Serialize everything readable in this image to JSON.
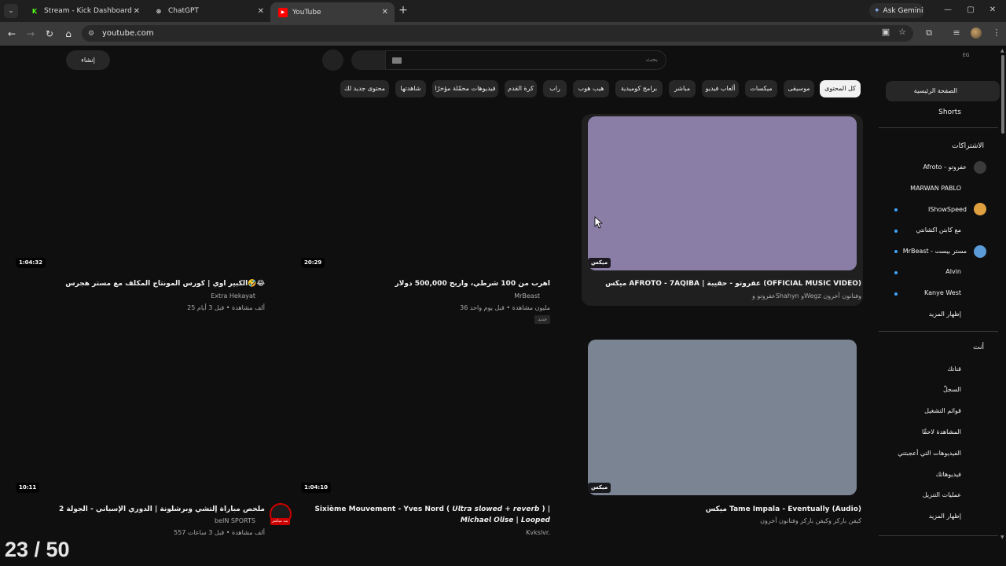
{
  "browser": {
    "tabs": [
      {
        "title": "Stream - Kick Dashboard",
        "favicon": "kick-icon",
        "color": "#53fc18"
      },
      {
        "title": "ChatGPT",
        "favicon": "chatgpt-icon",
        "color": "#e0e0e0"
      },
      {
        "title": "YouTube",
        "favicon": "youtube-icon",
        "color": "#ff0000",
        "active": true
      }
    ],
    "gemini_label": "Ask Gemini",
    "url": "youtube.com"
  },
  "header": {
    "create_label": "إنشاء",
    "search_placeholder": "بحث",
    "region": "EG"
  },
  "chips": [
    {
      "label": "كل المحتوى",
      "active": true
    },
    {
      "label": "موسيقى"
    },
    {
      "label": "ميكسات"
    },
    {
      "label": "ألعاب فيديو"
    },
    {
      "label": "مباشر"
    },
    {
      "label": "برامج كوميدية"
    },
    {
      "label": "هيب هوب"
    },
    {
      "label": "راب"
    },
    {
      "label": "كرة القدم"
    },
    {
      "label": "فيديوهات محمّلة مؤخرًا"
    },
    {
      "label": "شاهدتها"
    },
    {
      "label": "محتوى جديد لك"
    }
  ],
  "sidebar": {
    "home": "الصفحة الرئيسية",
    "shorts": "Shorts",
    "subs_heading": "الاشتراكات",
    "subscriptions": [
      {
        "name": "Afroto - عفروتو",
        "new": false
      },
      {
        "name": "MARWAN PABLO",
        "new": false
      },
      {
        "name": "IShowSpeed",
        "new": true
      },
      {
        "name": "مع كابتن اكشانتي",
        "new": true
      },
      {
        "name": "MrBeast - مستر بيست",
        "new": true
      },
      {
        "name": "Alvin",
        "new": true
      },
      {
        "name": "Kanye West",
        "new": true
      }
    ],
    "subs_more": "إظهار المزيد",
    "you_heading": "أنت",
    "you_items": [
      "قناتك",
      "السجلّ",
      "قوائم التشغيل",
      "المشاهدة لاحقًا",
      "الفيديوهات التي أعجبتني",
      "فيديوهاتك",
      "عمليات التنزيل",
      "إظهار المزيد"
    ]
  },
  "videos": [
    {
      "title": "ميكس AFROTO - 7AQIBA | عفروتو - حقيبة (OFFICIAL MUSIC VIDEO)",
      "meta1": "عفروتو وShahyn وWegz وفنانون آخرون",
      "meta2": "",
      "badge": "ميكس",
      "thumb_color": "#8a7ea6"
    },
    {
      "title": "اهرب من 100 شرطي، واربح 500,000 دولار",
      "meta1": "MrBeast",
      "meta2": "36 مليون مشاهدة • قبل يوم واحد",
      "badge": "20:29",
      "tag": "جديد"
    },
    {
      "title": "الكبير اوي | كورس المونتاج المكلف مع مستر هجرس🤣😂",
      "meta1": "Extra Hekayat",
      "meta2": "25 ألف مشاهدة • قبل 3 أيام",
      "badge": "1:04:32"
    },
    {
      "title": "ميكس Tame Impala - Eventually (Audio)",
      "meta1": "كيفن باركر وكيفن باركر وفنانون آخرون",
      "meta2": "",
      "badge": "ميكس",
      "thumb_color": "#7a8492"
    },
    {
      "title": "Sixième Mouvement - Yves Nord ( 𝙐𝙡𝙩𝙧𝙖 𝙨𝙡𝙤𝙬𝙚𝙙 + 𝙧𝙚𝙫𝙚𝙧𝙗 ) |",
      "title2": "𝙈𝙞𝙘𝙝𝙖𝙚𝙡 𝙊𝙡𝙞𝙨𝙚 | 𝙇𝙤𝙤𝙥𝙚𝙙",
      "meta1": "Kvkslvr.",
      "meta2": "",
      "badge": "1:04:10"
    },
    {
      "title": "ملخص مباراة إلتشي وبرشلونة | الدوري الإسباني - الجولة 2",
      "meta1": "beIN SPORTS",
      "meta2": "557 ألف مشاهدة • قبل 3 ساعات",
      "badge": "10:11",
      "live_tag": "بث مباشر"
    }
  ],
  "overlay_counter": "23 / 50"
}
